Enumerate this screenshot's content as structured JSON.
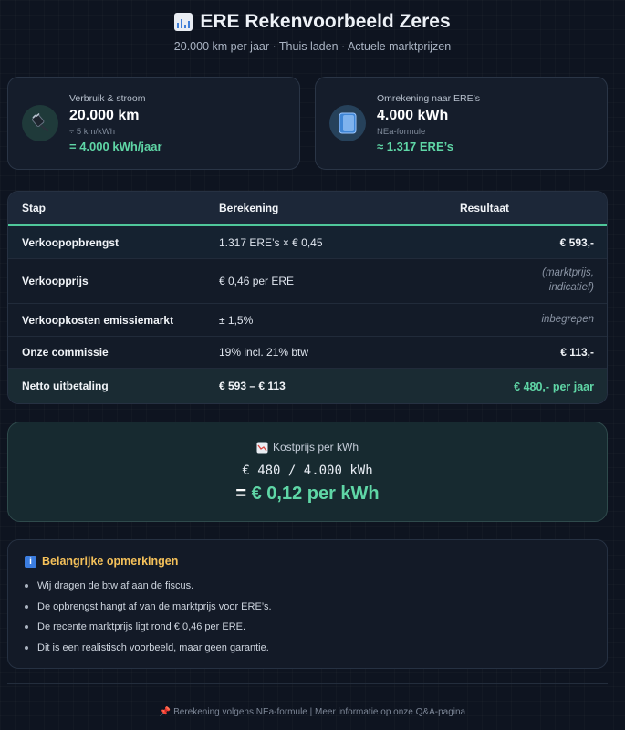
{
  "header": {
    "title": "ERE Rekenvoorbeeld Zeres",
    "icon": "bar-chart-icon",
    "subtitle": "20.000 km per jaar · Thuis laden · Actuele marktprijzen"
  },
  "cards": [
    {
      "icon": "plug-icon",
      "label": "Verbruik & stroom",
      "value": "20.000 km",
      "sub": "÷ 5 km/kWh",
      "result": "= 4.000 kWh/jaar"
    },
    {
      "icon": "book-icon",
      "label": "Omrekening naar ERE’s",
      "value": "4.000 kWh",
      "sub": "NEa-formule",
      "result": "≈ 1.317 ERE’s"
    }
  ],
  "table": {
    "headers": [
      "Stap",
      "Berekening",
      "Resultaat"
    ],
    "rows": [
      {
        "step": "Verkoopopbrengst",
        "calc": "1.317 ERE’s × € 0,45",
        "result": "€ 593,-"
      },
      {
        "step": "Verkoopprijs",
        "calc": "€ 0,46 per ERE",
        "result_line1": "(marktprijs,",
        "result_line2": "indicatief)"
      },
      {
        "step": "Verkoopkosten emissiemarkt",
        "calc": "± 1,5%",
        "result": "inbegrepen"
      },
      {
        "step": "Onze commissie",
        "calc": "19% incl. 21% btw",
        "result": "€ 113,-"
      },
      {
        "step": "Netto uitbetaling",
        "calc": "€ 593 – € 113",
        "result": "€ 480,-",
        "result_suffix": "per jaar"
      }
    ]
  },
  "cost": {
    "icon": "chart-trend-icon",
    "label": "Kostprijs per kWh",
    "formula": "€ 480 / 4.000 kWh",
    "equals": "=",
    "result": "€ 0,12 per kWh"
  },
  "notes": {
    "icon": "info-icon",
    "title": "Belangrijke opmerkingen",
    "items": [
      "Wij dragen de btw af aan de fiscus.",
      "De opbrengst hangt af van de marktprijs voor ERE’s.",
      "De recente marktprijs ligt rond € 0,46 per ERE.",
      "Dit is een realistisch voorbeeld, maar geen garantie."
    ]
  },
  "footer": {
    "icon": "pin-icon",
    "text": "Berekening volgens NEa-formule | Meer informatie op onze Q&A-pagina"
  },
  "colors": {
    "background": "#0e1420",
    "accent_green": "#5fd6a6",
    "notes_title": "#f5c15a"
  }
}
